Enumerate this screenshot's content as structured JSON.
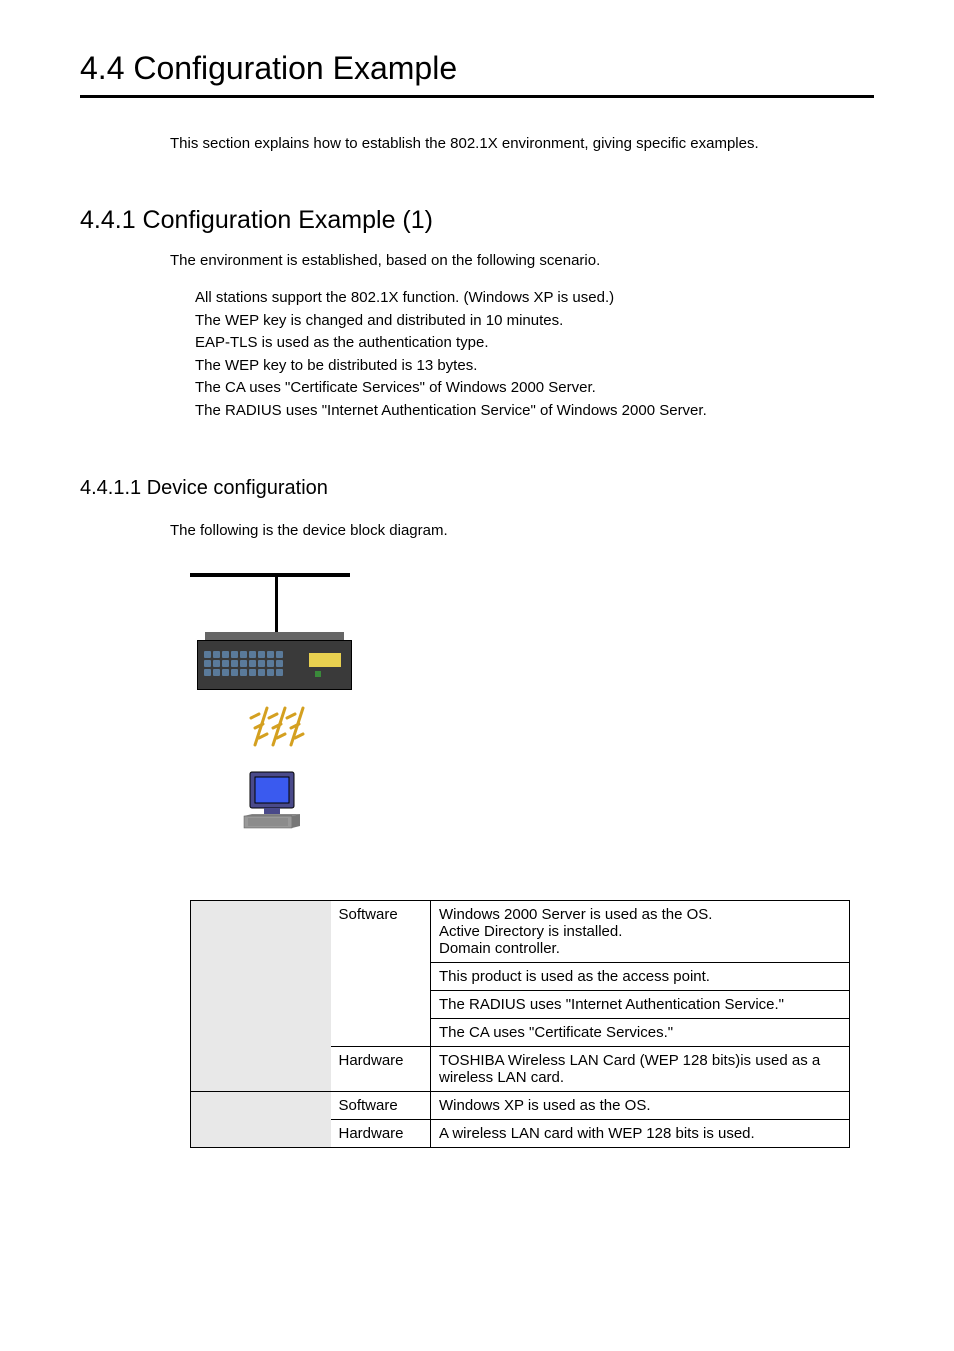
{
  "title": "4.4  Configuration Example",
  "intro": "This section explains how to establish the 802.1X environment, giving specific examples.",
  "subsection": {
    "title": "4.4.1  Configuration Example (1)",
    "intro": "The environment is established, based on the following scenario.",
    "scenarios": [
      "All stations support the 802.1X function.  (Windows XP is used.)",
      "The WEP key is changed and distributed in 10 minutes.",
      "EAP-TLS is used as the authentication type.",
      "The WEP key to be distributed is 13 bytes.",
      "The CA uses \"Certificate Services\" of Windows 2000 Server.",
      "The RADIUS uses \"Internet Authentication Service\" of Windows 2000 Server."
    ]
  },
  "subsubsection": {
    "title": "4.4.1.1 Device configuration",
    "intro": "The following is the device block diagram."
  },
  "table": {
    "rows": [
      {
        "a": "",
        "b": "Software",
        "c": "Windows 2000 Server is used as the OS.\nActive Directory is installed.\nDomain controller.",
        "arow": 5,
        "brow": 3
      },
      {
        "c": "This product is used as the access point."
      },
      {
        "c": "The RADIUS uses \"Internet Authentication Service.\""
      },
      {
        "b": "",
        "c": "The CA uses \"Certificate Services.\"",
        "brow": 1,
        "hideB": true
      },
      {
        "b": "Hardware",
        "c": "TOSHIBA Wireless LAN Card (WEP 128 bits)is used as a wireless LAN card.",
        "brow": 1
      },
      {
        "a": "",
        "b": "Software",
        "c": "Windows XP is used as the OS.",
        "arow": 2,
        "brow": 1
      },
      {
        "b": "Hardware",
        "c": "A wireless LAN card with WEP 128 bits is used.",
        "brow": 1
      }
    ]
  }
}
